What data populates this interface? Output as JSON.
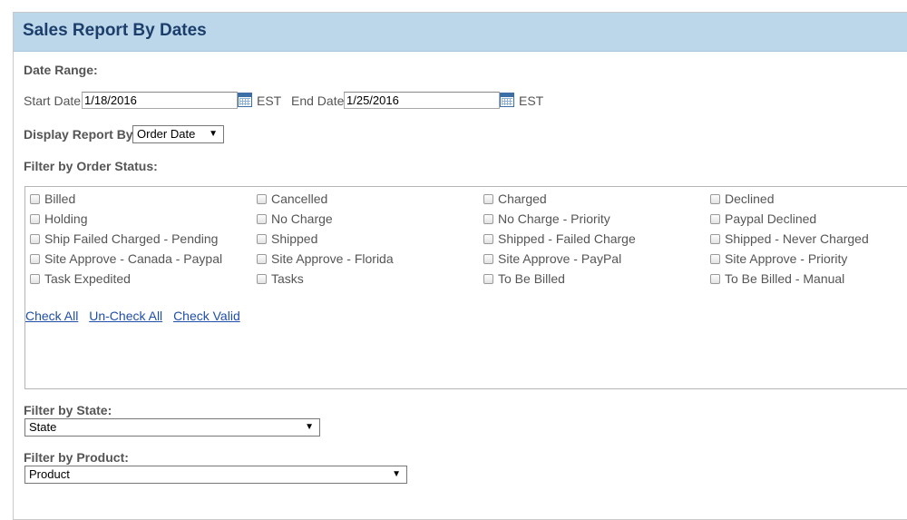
{
  "header": {
    "title": "Sales Report By Dates"
  },
  "date_range": {
    "label": "Date Range:",
    "start_label": "Start Date",
    "start_value": "1/18/2016",
    "start_tz": "EST",
    "end_label": "End Date",
    "end_value": "1/25/2016",
    "end_tz": "EST"
  },
  "display_by": {
    "label": "Display Report By:",
    "selected": "Order Date"
  },
  "order_status": {
    "label": "Filter by Order Status:",
    "items": [
      "Billed",
      "Cancelled",
      "Charged",
      "Declined",
      "Holding",
      "No Charge",
      "No Charge - Priority",
      "Paypal Declined",
      "Ship Failed Charged - Pending",
      "Shipped",
      "Shipped - Failed Charge",
      "Shipped - Never Charged",
      "Site Approve - Canada - Paypal",
      "Site Approve - Florida",
      "Site Approve - PayPal",
      "Site Approve - Priority",
      "Task Expedited",
      "Tasks",
      "To Be Billed",
      "To Be Billed - Manual"
    ],
    "links": {
      "check_all": "Check All",
      "uncheck_all": "Un-Check All",
      "check_valid": "Check Valid"
    }
  },
  "state_filter": {
    "label": "Filter by State:",
    "selected": "State"
  },
  "product_filter": {
    "label": "Filter by Product:",
    "selected": "Product"
  }
}
